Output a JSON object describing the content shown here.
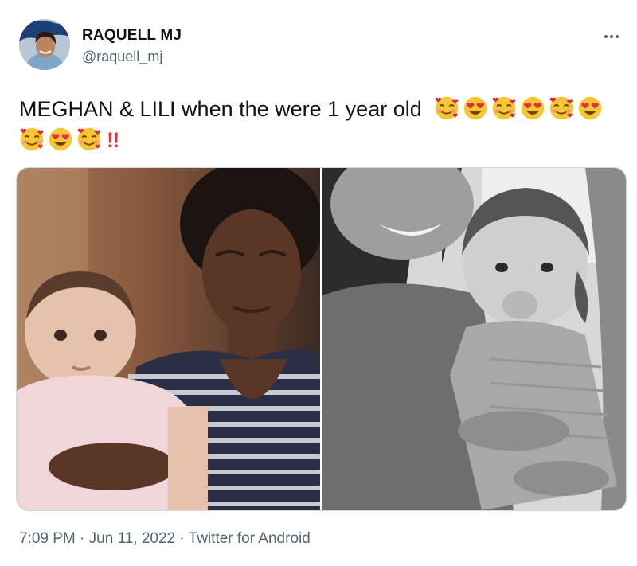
{
  "tweet": {
    "author_name": "RAQUELL MJ",
    "author_handle": "@raquell_mj",
    "text": "MEGHAN & LILI when the were 1 year old",
    "emojis": [
      "smiling-face-with-hearts",
      "heart-eyes",
      "smiling-face-with-hearts",
      "heart-eyes",
      "smiling-face-with-hearts",
      "heart-eyes",
      "smiling-face-with-hearts",
      "heart-eyes",
      "smiling-face-with-hearts"
    ],
    "exclamation": "‼",
    "time": "7:09 PM",
    "separator": "·",
    "date": "Jun 11, 2022",
    "source": "Twitter for Android"
  },
  "media": {
    "left_photo": "baby-held-by-woman-in-striped-top-color",
    "right_photo": "smiling-woman-holding-baby-black-and-white"
  },
  "colors": {
    "text_primary": "#0f1419",
    "text_secondary": "#536471",
    "border": "#cfd9de",
    "emoji_yellow": "#f7c533",
    "heart_red": "#e0303a"
  }
}
